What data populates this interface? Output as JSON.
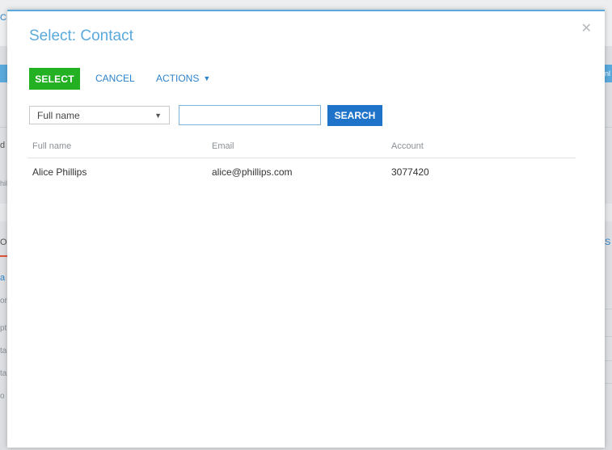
{
  "background": {
    "fragments": [
      "CE",
      "d ,",
      "hil",
      "O",
      "a",
      "on",
      "pt",
      "ta",
      "ta",
      "o F",
      "S",
      "nl"
    ]
  },
  "modal": {
    "title": "Select: Contact",
    "close_icon": "close-icon",
    "toolbar": {
      "select_label": "SELECT",
      "cancel_label": "CANCEL",
      "actions_label": "ACTIONS"
    },
    "filter": {
      "column_selected": "Full name",
      "search_value": "",
      "search_label": "SEARCH"
    },
    "grid": {
      "columns": [
        "Full name",
        "Email",
        "Account"
      ],
      "rows": [
        {
          "full_name": "Alice Phillips",
          "email": "alice@phillips.com",
          "account": "3077420"
        }
      ]
    }
  },
  "colors": {
    "accent": "#5aa9dc",
    "select_button": "#24b023",
    "search_button": "#1f74c9",
    "link": "#2d82c8"
  }
}
